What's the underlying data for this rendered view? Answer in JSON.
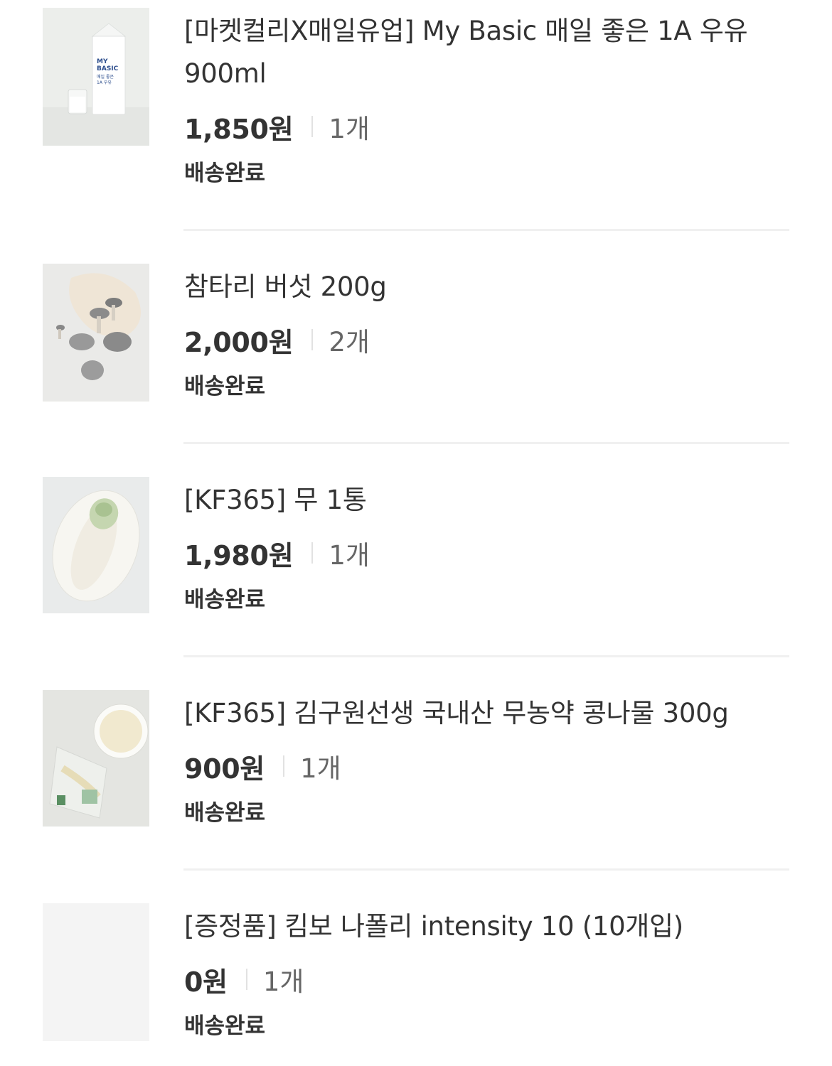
{
  "items": [
    {
      "name": "[마켓컬리X매일유업] My Basic 매일 좋은 1A 우유 900ml",
      "price": "1,850원",
      "quantity": "1개",
      "status": "배송완료",
      "thumbnail_icon": "milk-carton-image",
      "package_text": [
        "MY",
        "BASIC",
        "매일 좋은",
        "1A 우유"
      ]
    },
    {
      "name": "참타리 버섯 200g",
      "price": "2,000원",
      "quantity": "2개",
      "status": "배송완료",
      "thumbnail_icon": "mushroom-image"
    },
    {
      "name": "[KF365] 무 1통",
      "price": "1,980원",
      "quantity": "1개",
      "status": "배송완료",
      "thumbnail_icon": "radish-image"
    },
    {
      "name": "[KF365] 김구원선생 국내산 무농약 콩나물 300g",
      "price": "900원",
      "quantity": "1개",
      "status": "배송완료",
      "thumbnail_icon": "bean-sprouts-image"
    },
    {
      "name": "[증정품] 킴보 나폴리 intensity 10 (10개입)",
      "price": "0원",
      "quantity": "1개",
      "status": "배송완료",
      "thumbnail_icon": "placeholder-image"
    }
  ]
}
